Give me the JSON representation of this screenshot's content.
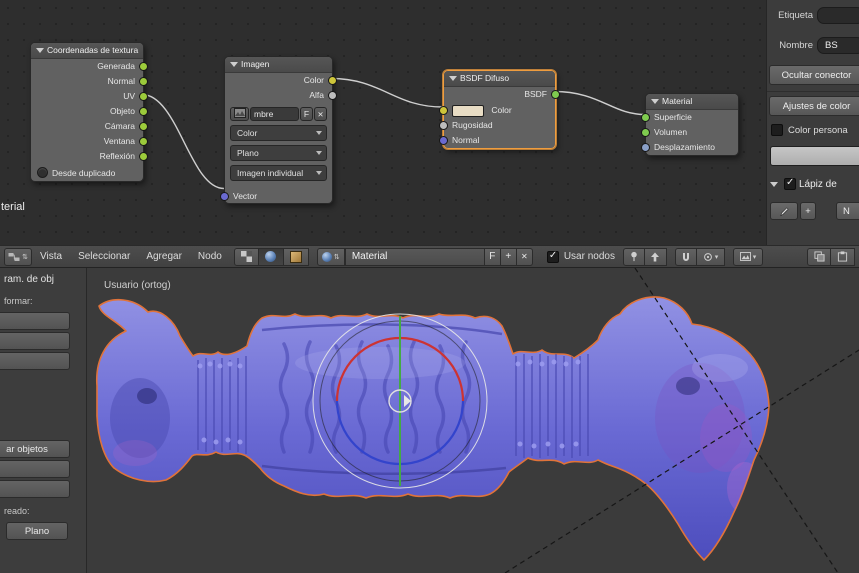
{
  "nodes": {
    "tex_coord": {
      "title": "Coordenadas de textura",
      "outputs": [
        "Generada",
        "Normal",
        "UV",
        "Objeto",
        "Cámara",
        "Ventana",
        "Reflexión"
      ],
      "toggle_label": "Desde duplicado"
    },
    "image": {
      "title": "Imagen",
      "output_color": "Color",
      "output_alpha": "Alfa",
      "name_value": "mbre",
      "fake_user": "F",
      "close_label": "✕",
      "select_color": "Color",
      "select_projection": "Plano",
      "select_source": "Imagen individual",
      "input_vector": "Vector"
    },
    "bsdf": {
      "title": "BSDF Difuso",
      "output": "BSDF",
      "input_color": "Color",
      "input_roughness": "Rugosidad",
      "input_normal": "Normal"
    },
    "output": {
      "title": "Material",
      "input_surface": "Superficie",
      "input_volume": "Volumen",
      "input_displacement": "Desplazamiento"
    },
    "partial_label": "terial"
  },
  "sidebar": {
    "label_row": {
      "label": "Etiqueta",
      "value": ""
    },
    "name_row": {
      "label": "Nombre",
      "value": "BS"
    },
    "hide_button": "Ocultar conector",
    "color_settings_button": "Ajustes de color",
    "custom_color_label": "Color persona",
    "grease_pencil_label": "Lápiz de",
    "plus": "+",
    "new_partial": "N"
  },
  "header": {
    "menus": [
      "Vista",
      "Seleccionar",
      "Agregar",
      "Nodo"
    ],
    "material_name": "Material",
    "fake_user": "F",
    "plus": "+",
    "close": "✕",
    "use_nodes_label": "Usar nodos"
  },
  "viewport": {
    "view_label": "Usuario (ortog)",
    "shelf_tab": "ram. de obj",
    "transform_label": "formar:",
    "duplicate_button": "ar objetos",
    "redo_label": "reado:",
    "plano_button": "Plano"
  },
  "colors": {
    "selection_outline": "#e0733a",
    "mesh_base": "#6a6ad2",
    "gizmo_red": "#cc3333",
    "gizmo_green": "#44aa44",
    "gizmo_blue": "#3344cc",
    "socket_vector": "#6a6ad0",
    "socket_color": "#cdc53a",
    "socket_shader": "#7fcb4f"
  }
}
